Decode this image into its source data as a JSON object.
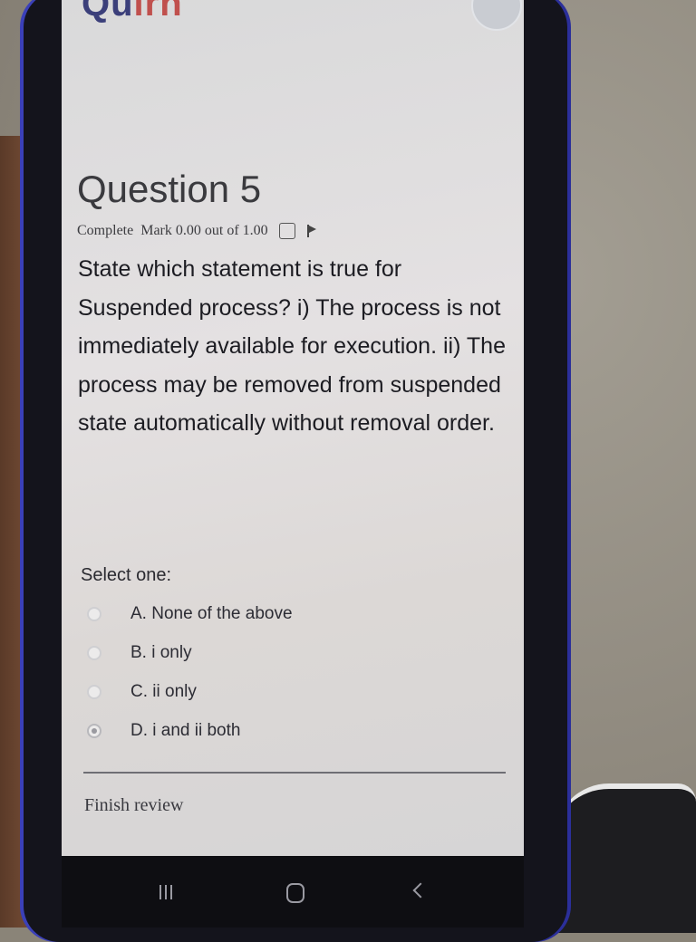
{
  "header": {
    "logo_text_main": "Qu",
    "logo_text_accent": "irn",
    "avatar_icon": "user-avatar-icon"
  },
  "question": {
    "title": "Question 5",
    "state": "Complete",
    "mark": "Mark 0.00 out of 1.00",
    "text": "State which statement is true for Suspended process? i) The process is not immediately available for execution. ii) The process may be removed from suspended state automatically without removal order."
  },
  "answer": {
    "prompt": "Select one:",
    "options": [
      {
        "label": "A. None of the above",
        "selected": false
      },
      {
        "label": "B. i only",
        "selected": false
      },
      {
        "label": "C. ii only",
        "selected": false
      },
      {
        "label": "D. i and ii both",
        "selected": true
      }
    ]
  },
  "footer": {
    "finish_review": "Finish review"
  },
  "colors": {
    "screen_bg": "#dcdadb",
    "text": "#1c1c22",
    "logo_primary": "#3b3f7a",
    "logo_accent": "#c0504d"
  }
}
